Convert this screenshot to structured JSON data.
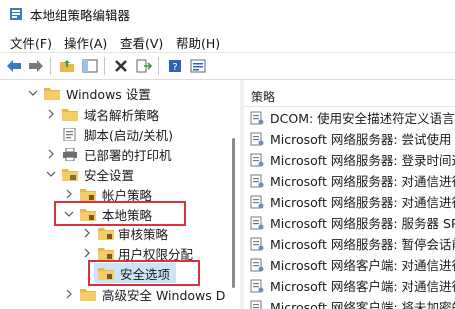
{
  "window": {
    "title": "本地组策略编辑器"
  },
  "menu": [
    "文件(F)",
    "操作(A)",
    "查看(V)",
    "帮助(H)"
  ],
  "toolbar": {
    "buttons": [
      {
        "name": "back-arrow-icon",
        "interactable": true
      },
      {
        "name": "forward-arrow-icon",
        "interactable": true
      },
      {
        "name": "up-folder-icon",
        "interactable": true
      },
      {
        "name": "show-hide-tree-icon",
        "interactable": true
      },
      {
        "name": "delete-x-icon",
        "interactable": true
      },
      {
        "name": "export-list-icon",
        "interactable": true
      },
      {
        "name": "help-icon",
        "interactable": true
      },
      {
        "name": "properties-icon",
        "interactable": true
      }
    ]
  },
  "tree": [
    {
      "label": "Windows 设置",
      "expanded": true
    },
    {
      "label": "域名解析策略",
      "expanded": false
    },
    {
      "label": "脚本(启动/关机)",
      "expanded": null
    },
    {
      "label": "已部署的打印机",
      "expanded": false
    },
    {
      "label": "安全设置",
      "expanded": true
    },
    {
      "label": "帐户策略",
      "expanded": false
    },
    {
      "label": "本地策略",
      "expanded": true
    },
    {
      "label": "审核策略",
      "expanded": false
    },
    {
      "label": "用户权限分配",
      "expanded": false
    },
    {
      "label": "安全选项",
      "expanded": null,
      "selected": true
    },
    {
      "label": "高级安全 Windows D",
      "expanded": false
    }
  ],
  "right_pane": {
    "column_header": "策略",
    "policies": [
      "DCOM: 使用安全描述符定义语言(S",
      "Microsoft 网络服务器: 尝试使用 S4",
      "Microsoft 网络服务器: 登录时间过",
      "Microsoft 网络服务器: 对通信进行",
      "Microsoft 网络服务器: 对通信进行",
      "Microsoft 网络服务器: 服务器 SPN",
      "Microsoft 网络服务器: 暂停会话前",
      "Microsoft 网络客户端: 对通信进行",
      "Microsoft 网络客户端: 对通信进行",
      "Microsoft 网络客户端: 将未加密的"
    ]
  },
  "colors": {
    "highlight_red": "#d9323a",
    "selected_blue": "#cce4f7",
    "folder_yellow": "#e8b84a"
  }
}
